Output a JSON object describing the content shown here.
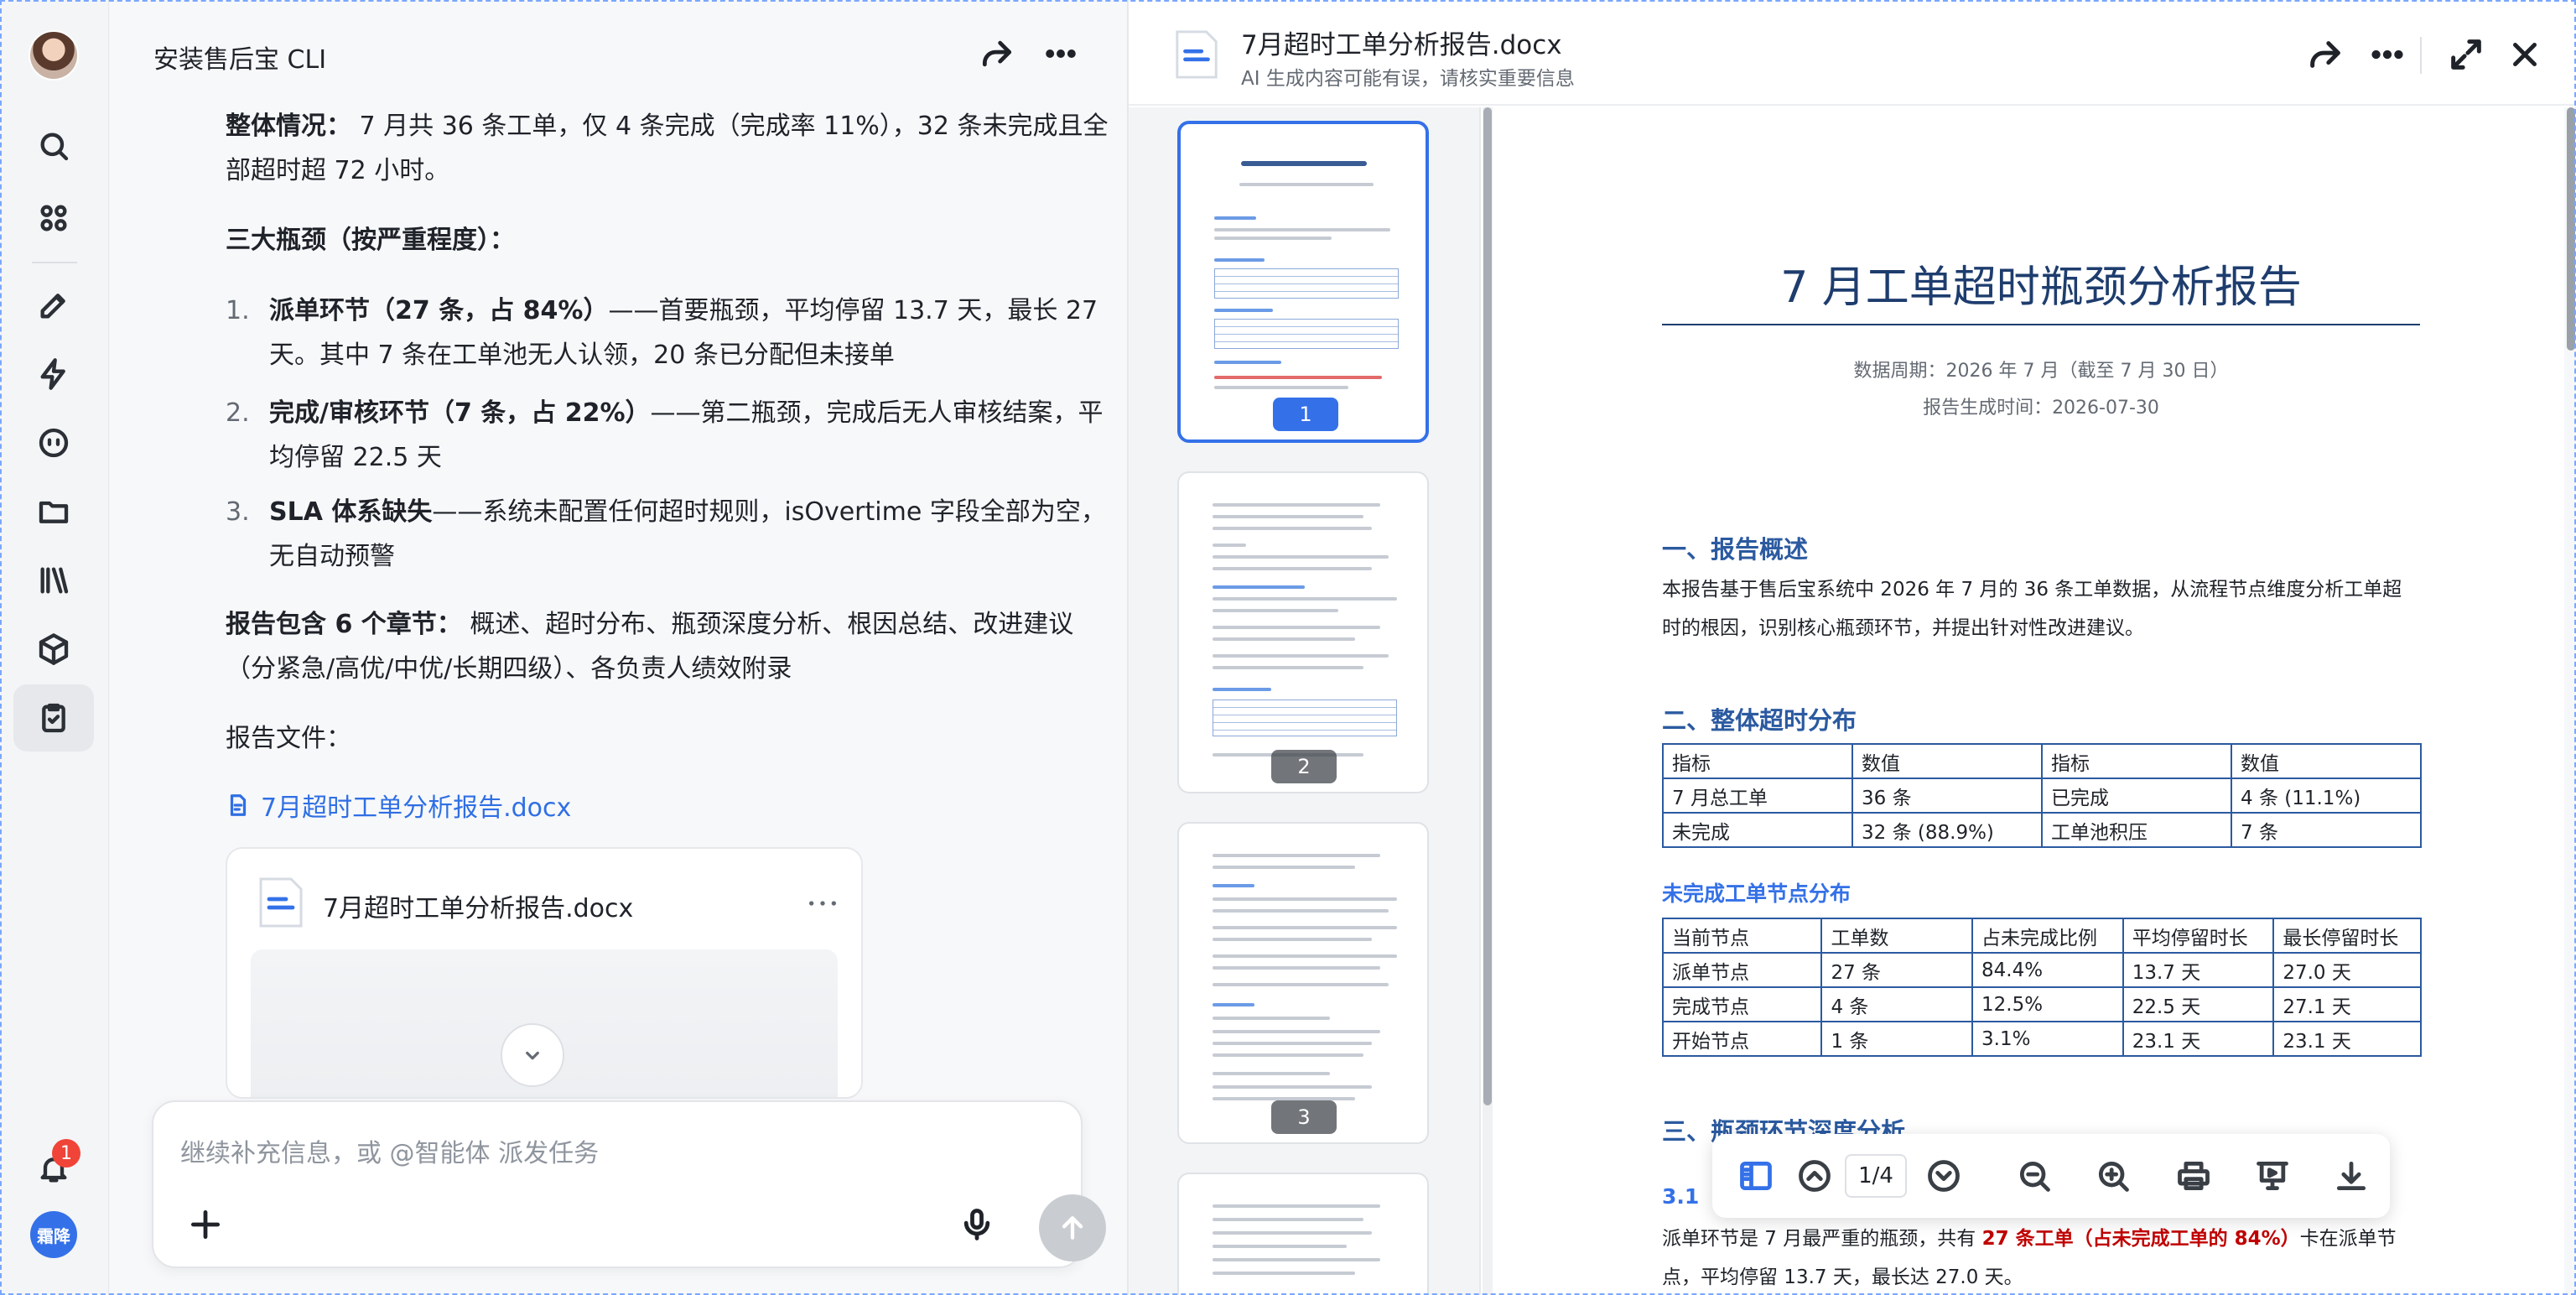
{
  "rail": {
    "notification_count": "1",
    "user_initials": "霜降"
  },
  "chat": {
    "title": "安装售后宝 CLI",
    "overall_label": "整体情况：",
    "overall_text": "7 月共 36 条工单，仅 4 条完成（完成率 11%），32 条未完成且全部超时超 72 小时。",
    "bottleneck_heading": "三大瓶颈（按严重程度）：",
    "bottlenecks": [
      {
        "num": "1.",
        "bold": "派单环节（27 条，占 84%）",
        "text": "——首要瓶颈，平均停留 13.7 天，最长 27 天。其中 7 条在工单池无人认领，20 条已分配但未接单"
      },
      {
        "num": "2.",
        "bold": "完成/审核环节（7 条，占 22%）",
        "text": "——第二瓶颈，完成后无人审核结案，平均停留 22.5 天"
      },
      {
        "num": "3.",
        "bold": "SLA 体系缺失",
        "text": "——系统未配置任何超时规则，isOvertime 字段全部为空，无自动预警"
      }
    ],
    "report_label": "报告包含 6 个章节：",
    "report_text": "概述、超时分布、瓶颈深度分析、根因总结、改进建议（分紧急/高优/中优/长期四级）、各负责人绩效附录",
    "file_label": "报告文件：",
    "file_link": "7月超时工单分析报告.docx",
    "card_filename": "7月超时工单分析报告.docx",
    "composer_placeholder": "继续补充信息，或 @智能体 派发任务"
  },
  "viewer": {
    "filename": "7月超时工单分析报告.docx",
    "subtitle": "AI 生成内容可能有误，请核实重要信息",
    "thumb_pages": [
      "1",
      "2",
      "3"
    ],
    "page_indicator": "1/4",
    "doc": {
      "title": "7 月工单超时瓶颈分析报告",
      "period": "数据周期：2026 年 7 月（截至 7 月 30 日）",
      "generated": "报告生成时间：2026-07-30",
      "s1_heading": "一、报告概述",
      "s1_text": "本报告基于售后宝系统中 2026 年 7 月的 36 条工单数据，从流程节点维度分析工单超时的根因，识别核心瓶颈环节，并提出针对性改进建议。",
      "s2_heading": "二、整体超时分布",
      "overview_table": [
        [
          "指标",
          "数值",
          "指标",
          "数值"
        ],
        [
          "7 月总工单",
          "36 条",
          "已完成",
          "4 条 (11.1%)"
        ],
        [
          "未完成",
          "32 条 (88.9%)",
          "工单池积压",
          "7 条"
        ]
      ],
      "s2_sub": "未完成工单节点分布",
      "node_table": [
        [
          "当前节点",
          "工单数",
          "占未完成比例",
          "平均停留时长",
          "最长停留时长"
        ],
        [
          "派单节点",
          "27 条",
          "84.4%",
          "13.7 天",
          "27.0 天"
        ],
        [
          "完成节点",
          "4 条",
          "12.5%",
          "22.5 天",
          "27.1 天"
        ],
        [
          "开始节点",
          "1 条",
          "3.1%",
          "23.1 天",
          "23.1 天"
        ]
      ],
      "s3_heading": "三、瓶颈环节深度分析",
      "s3_sub": "3.1",
      "s3_text_a": "派单环节是 7 月最严重的瓶颈，共有 ",
      "s3_text_red": "27 条工单（占未完成工单的 84%）",
      "s3_text_b": "卡在派单节点，平均停留 13.7 天，最长达 27.0 天。"
    }
  },
  "colors": {
    "accent": "#3471e8",
    "doc_heading": "#2b5aa0",
    "highlight_red": "#c00000"
  }
}
